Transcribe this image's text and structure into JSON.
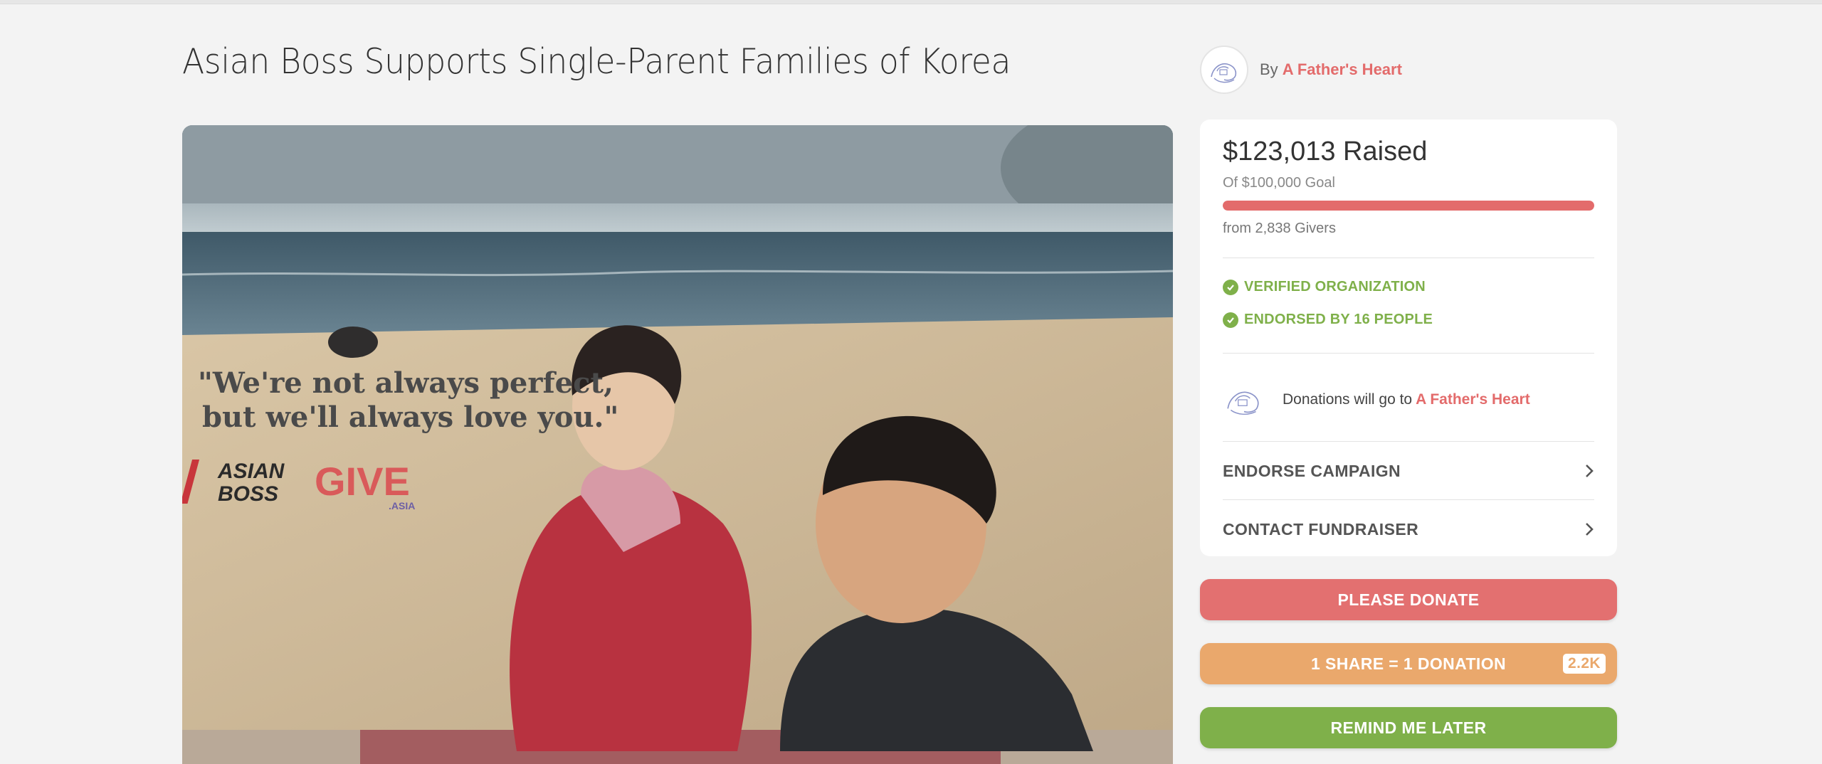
{
  "campaign": {
    "title": "Asian Boss Supports Single-Parent Families of Korea",
    "by_label": "By",
    "organizer": "A Father's Heart"
  },
  "hero": {
    "quote_line1": "\"We're not always perfect,",
    "quote_line2": "but we'll always love you.\"",
    "logo_asian_boss_line1": "ASIAN",
    "logo_asian_boss_line2": "BOSS",
    "logo_give": "GIVE",
    "logo_give_sub": ".ASIA"
  },
  "stats": {
    "raised": "$123,013 Raised",
    "goal": "Of $100,000 Goal",
    "givers": "from 2,838 Givers",
    "progress_fraction": 1.0
  },
  "badges": [
    {
      "label": "VERIFIED ORGANIZATION",
      "icon": "check-circle-icon"
    },
    {
      "label": "ENDORSED BY 16 PEOPLE",
      "icon": "check-circle-icon"
    }
  ],
  "destination": {
    "text": "Donations will go to",
    "org": "A Father's Heart"
  },
  "menu": {
    "endorse": "ENDORSE CAMPAIGN",
    "contact": "CONTACT FUNDRAISER"
  },
  "buttons": {
    "donate": "PLEASE DONATE",
    "share": "1 SHARE = 1 DONATION",
    "share_count": "2.2K",
    "remind": "REMIND ME LATER"
  },
  "colors": {
    "accent": "#e36b6b",
    "verified": "#7fb04a",
    "share": "#eaa86c",
    "remind": "#7fb04a"
  }
}
